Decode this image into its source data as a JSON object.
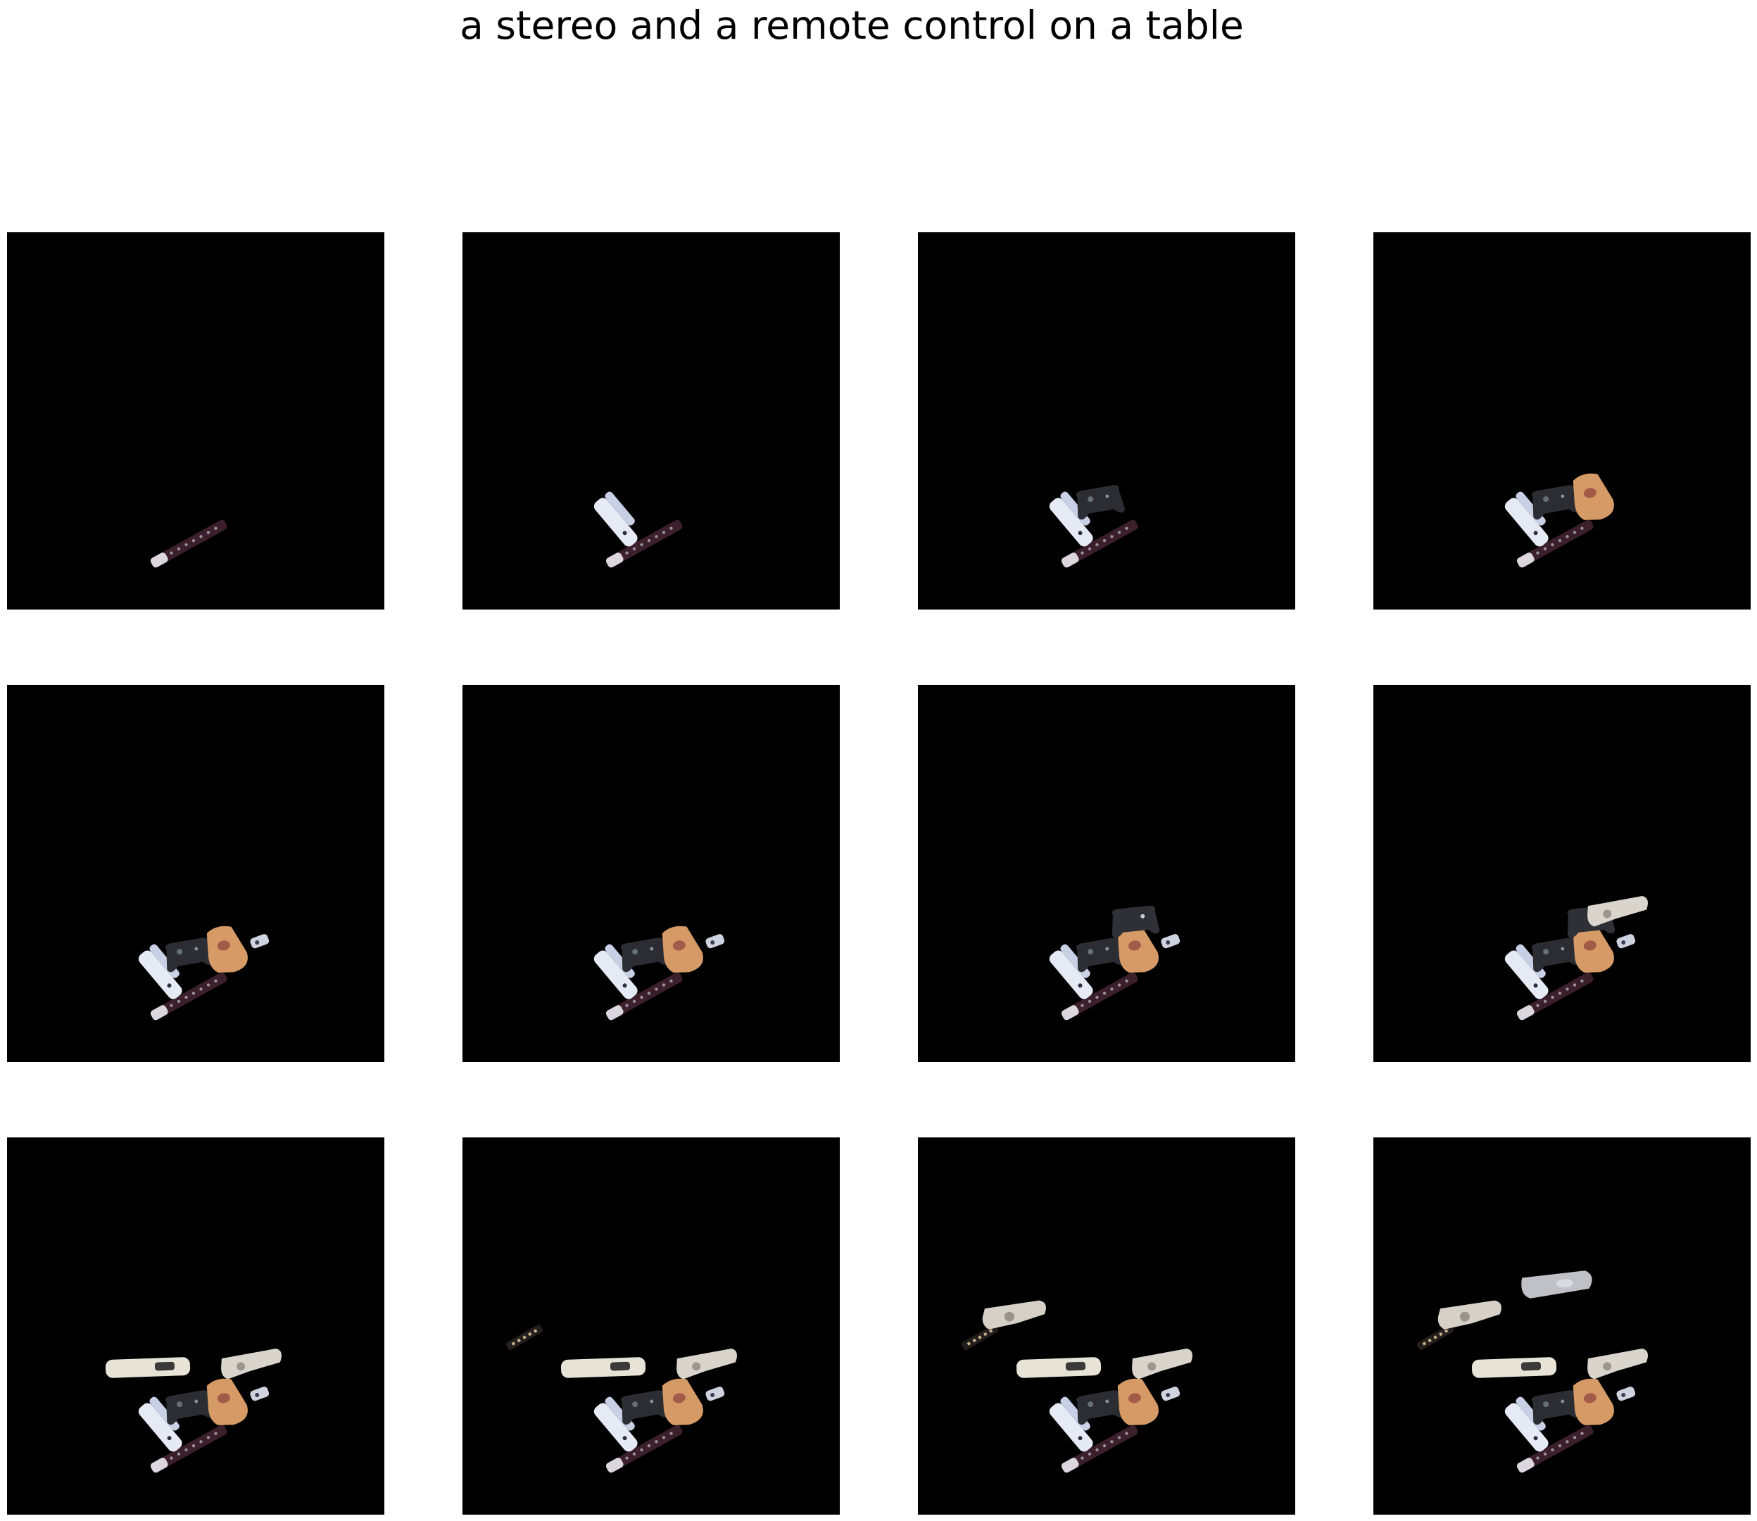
{
  "figure": {
    "title": "a stereo and a remote control on a table",
    "background_color": "#ffffff",
    "panel_color": "#000000"
  },
  "grid": {
    "rows": 3,
    "columns": 4
  },
  "panels": [
    {
      "index": 1,
      "objects": [
        "remote-control"
      ]
    },
    {
      "index": 2,
      "objects": [
        "remote-control",
        "white-remote"
      ]
    },
    {
      "index": 3,
      "objects": [
        "remote-control",
        "white-remote",
        "game-controller"
      ]
    },
    {
      "index": 4,
      "objects": [
        "remote-control",
        "white-remote",
        "game-controller",
        "tan-speaker"
      ]
    },
    {
      "index": 5,
      "objects": [
        "remote-control",
        "white-remote",
        "game-controller",
        "tan-speaker",
        "small-device"
      ]
    },
    {
      "index": 6,
      "objects": [
        "remote-control",
        "white-remote",
        "game-controller",
        "tan-speaker",
        "small-device"
      ]
    },
    {
      "index": 7,
      "objects": [
        "remote-control",
        "white-remote",
        "game-controller",
        "tan-speaker",
        "small-device",
        "second-controller"
      ]
    },
    {
      "index": 8,
      "objects": [
        "remote-control",
        "white-remote",
        "game-controller",
        "tan-speaker",
        "small-device",
        "second-controller",
        "beige-stereo"
      ]
    },
    {
      "index": 9,
      "objects": [
        "remote-control",
        "white-remote",
        "game-controller",
        "tan-speaker",
        "small-device",
        "beige-stereo",
        "long-white-stereo"
      ]
    },
    {
      "index": 10,
      "objects": [
        "remote-control",
        "white-remote",
        "game-controller",
        "tan-speaker",
        "small-device",
        "beige-stereo",
        "long-white-stereo",
        "small-dark-remote"
      ]
    },
    {
      "index": 11,
      "objects": [
        "remote-control",
        "white-remote",
        "game-controller",
        "tan-speaker",
        "small-device",
        "beige-stereo",
        "long-white-stereo",
        "small-dark-remote",
        "left-beige-stereo"
      ]
    },
    {
      "index": 12,
      "objects": [
        "remote-control",
        "white-remote",
        "game-controller",
        "tan-speaker",
        "small-device",
        "beige-stereo",
        "long-white-stereo",
        "small-dark-remote",
        "left-beige-stereo",
        "gray-stereo-top"
      ]
    }
  ]
}
